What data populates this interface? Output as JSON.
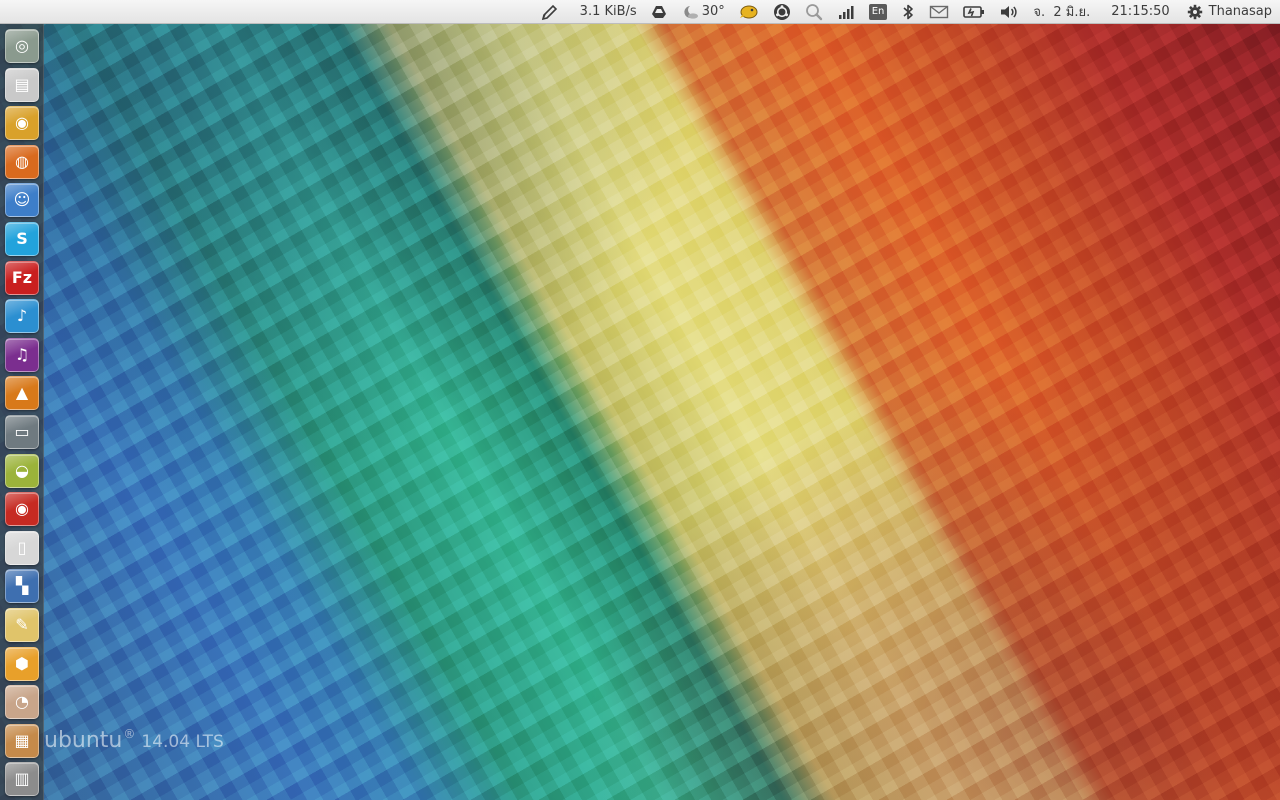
{
  "panel": {
    "net_speed": "3.1 KiB/s",
    "weather": "30°",
    "keyboard_layout": "En",
    "date": "จ.  2 มิ.ย.",
    "time": "21:15:50",
    "user": "Thanasap",
    "icons": {
      "pen": "pen-icon",
      "drive": "google-drive-icon",
      "weather": "moon-weather-icon",
      "pidgin": "pidgin-messenger-icon",
      "ubuntu_one": "ubuntu-sync-icon",
      "search": "search-icon",
      "network": "network-signal-icon",
      "bluetooth": "bluetooth-icon",
      "mail": "mail-icon",
      "battery": "battery-icon",
      "volume": "volume-icon",
      "gear": "gear-icon"
    }
  },
  "launcher": {
    "items": [
      {
        "name": "dash-home",
        "icon": "ubuntu-logo-icon",
        "color": "#8a9a8e",
        "glyph": "◎"
      },
      {
        "name": "files",
        "icon": "file-cabinet-icon",
        "color": "#c9c9c9",
        "glyph": "▤"
      },
      {
        "name": "chrome",
        "icon": "chrome-icon",
        "color": "#d9a12a",
        "glyph": "◉"
      },
      {
        "name": "firefox",
        "icon": "firefox-icon",
        "color": "#d96a1e",
        "glyph": "◍"
      },
      {
        "name": "empathy",
        "icon": "chat-bubble-icon",
        "color": "#3d7ec9",
        "glyph": "☺"
      },
      {
        "name": "skype",
        "icon": "skype-icon",
        "color": "#22a3dc",
        "glyph": "S"
      },
      {
        "name": "filezilla",
        "icon": "filezilla-icon",
        "color": "#c91f1f",
        "glyph": "Fz"
      },
      {
        "name": "deadbeef",
        "icon": "music-note-icon",
        "color": "#2b8fd1",
        "glyph": "♪"
      },
      {
        "name": "audio-player",
        "icon": "headphones-icon",
        "color": "#7b2e8f",
        "glyph": "♫"
      },
      {
        "name": "vlc",
        "icon": "vlc-cone-icon",
        "color": "#d8791a",
        "glyph": "▲"
      },
      {
        "name": "video-player",
        "icon": "tv-icon",
        "color": "#6f7a80",
        "glyph": "▭"
      },
      {
        "name": "wine",
        "icon": "wine-glass-icon",
        "color": "#9bb33a",
        "glyph": "◒"
      },
      {
        "name": "disc-burner",
        "icon": "disc-icon",
        "color": "#c62a22",
        "glyph": "◉"
      },
      {
        "name": "documents",
        "icon": "document-icon",
        "color": "#d7d7d7",
        "glyph": "▯"
      },
      {
        "name": "libreoffice",
        "icon": "office-icon",
        "color": "#3e6fb0",
        "glyph": "▚"
      },
      {
        "name": "text-editor",
        "icon": "notepad-icon",
        "color": "#e0c46a",
        "glyph": "✎"
      },
      {
        "name": "unity-tweak",
        "icon": "hexagon-icon",
        "color": "#e8a02a",
        "glyph": "⬢"
      },
      {
        "name": "eye-of-gnome",
        "icon": "eye-icon",
        "color": "#c8a58a",
        "glyph": "◔"
      },
      {
        "name": "image-viewer",
        "icon": "photo-icon",
        "color": "#c58a4a",
        "glyph": "▦"
      },
      {
        "name": "trash",
        "icon": "trash-icon",
        "color": "#8c8c8c",
        "glyph": "▥"
      }
    ]
  },
  "watermark": {
    "brand": "ubuntu",
    "reg": "®",
    "version": "14.04 LTS"
  }
}
